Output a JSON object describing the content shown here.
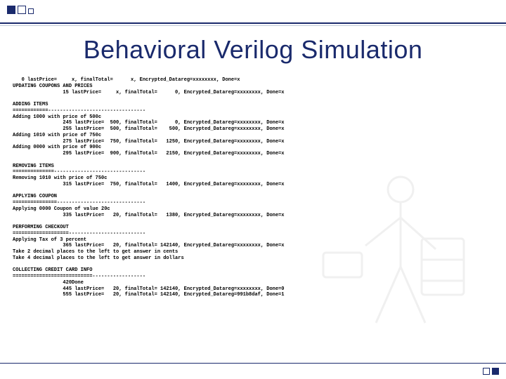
{
  "title": "Behavioral Verilog Simulation",
  "log": {
    "lines": [
      "   0 lastPrice=     x, finalTotal=      x, Encrypted_Datareg=xxxxxxxx, Done=x",
      "UPDATING COUPONS AND PRICES",
      "                 15 lastPrice=     x, finalTotal=      0, Encrypted_Datareg=xxxxxxxx, Done=x",
      "",
      "ADDING ITEMS",
      "============---------------------------------",
      "Adding 1000 with price of 500c",
      "                 245 lastPrice=  500, finalTotal=      0, Encrypted_Datareg=xxxxxxxx, Done=x",
      "                 255 lastPrice=  500, finalTotal=    500, Encrypted_Datareg=xxxxxxxx, Done=x",
      "Adding 1010 with price of 750c",
      "                 275 lastPrice=  750, finalTotal=   1250, Encrypted_Datareg=xxxxxxxx, Done=x",
      "Adding 0000 with price of 900c",
      "                 295 lastPrice=  900, finalTotal=   2150, Encrypted_Datareg=xxxxxxxx, Done=x",
      "",
      "REMOVING ITEMS",
      "==============-------------------------------",
      "Removing 1010 with price of 750c",
      "                 315 lastPrice=  750, finalTotal=   1400, Encrypted_Datareg=xxxxxxxx, Done=x",
      "",
      "APPLYING COUPON",
      "===============------------------------------",
      "Applying 0000 Coupon of value 20c",
      "                 335 lastPrice=   20, finalTotal=   1380, Encrypted_Datareg=xxxxxxxx, Done=x",
      "",
      "PERFORMING CHECKOUT",
      "===================--------------------------",
      "Applying Tax of 3 percent",
      "                 365 lastPrice=   20, finalTotal= 142140, Encrypted_Datareg=xxxxxxxx, Done=x",
      "Take 2 decimal places to the left to get answer in cents",
      "Take 4 decimal places to the left to get answer in dollars",
      "",
      "COLLECTING CREDIT CARD INFO",
      "===========================------------------",
      "                 420Done",
      "                 445 lastPrice=   20, finalTotal= 142140, Encrypted_Datareg=xxxxxxxx, Done=0",
      "                 555 lastPrice=   20, finalTotal= 142140, Encrypted_Datareg=991b8daf, Done=1"
    ]
  }
}
